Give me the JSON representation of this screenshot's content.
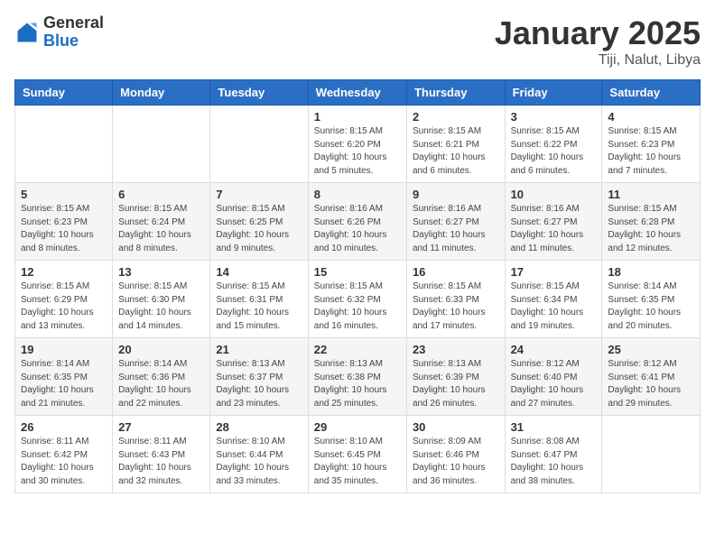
{
  "header": {
    "logo_general": "General",
    "logo_blue": "Blue",
    "title": "January 2025",
    "location": "Tiji, Nalut, Libya"
  },
  "days_of_week": [
    "Sunday",
    "Monday",
    "Tuesday",
    "Wednesday",
    "Thursday",
    "Friday",
    "Saturday"
  ],
  "weeks": [
    [
      {
        "day": "",
        "info": ""
      },
      {
        "day": "",
        "info": ""
      },
      {
        "day": "",
        "info": ""
      },
      {
        "day": "1",
        "info": "Sunrise: 8:15 AM\nSunset: 6:20 PM\nDaylight: 10 hours and 5 minutes."
      },
      {
        "day": "2",
        "info": "Sunrise: 8:15 AM\nSunset: 6:21 PM\nDaylight: 10 hours and 6 minutes."
      },
      {
        "day": "3",
        "info": "Sunrise: 8:15 AM\nSunset: 6:22 PM\nDaylight: 10 hours and 6 minutes."
      },
      {
        "day": "4",
        "info": "Sunrise: 8:15 AM\nSunset: 6:23 PM\nDaylight: 10 hours and 7 minutes."
      }
    ],
    [
      {
        "day": "5",
        "info": "Sunrise: 8:15 AM\nSunset: 6:23 PM\nDaylight: 10 hours and 8 minutes."
      },
      {
        "day": "6",
        "info": "Sunrise: 8:15 AM\nSunset: 6:24 PM\nDaylight: 10 hours and 8 minutes."
      },
      {
        "day": "7",
        "info": "Sunrise: 8:15 AM\nSunset: 6:25 PM\nDaylight: 10 hours and 9 minutes."
      },
      {
        "day": "8",
        "info": "Sunrise: 8:16 AM\nSunset: 6:26 PM\nDaylight: 10 hours and 10 minutes."
      },
      {
        "day": "9",
        "info": "Sunrise: 8:16 AM\nSunset: 6:27 PM\nDaylight: 10 hours and 11 minutes."
      },
      {
        "day": "10",
        "info": "Sunrise: 8:16 AM\nSunset: 6:27 PM\nDaylight: 10 hours and 11 minutes."
      },
      {
        "day": "11",
        "info": "Sunrise: 8:15 AM\nSunset: 6:28 PM\nDaylight: 10 hours and 12 minutes."
      }
    ],
    [
      {
        "day": "12",
        "info": "Sunrise: 8:15 AM\nSunset: 6:29 PM\nDaylight: 10 hours and 13 minutes."
      },
      {
        "day": "13",
        "info": "Sunrise: 8:15 AM\nSunset: 6:30 PM\nDaylight: 10 hours and 14 minutes."
      },
      {
        "day": "14",
        "info": "Sunrise: 8:15 AM\nSunset: 6:31 PM\nDaylight: 10 hours and 15 minutes."
      },
      {
        "day": "15",
        "info": "Sunrise: 8:15 AM\nSunset: 6:32 PM\nDaylight: 10 hours and 16 minutes."
      },
      {
        "day": "16",
        "info": "Sunrise: 8:15 AM\nSunset: 6:33 PM\nDaylight: 10 hours and 17 minutes."
      },
      {
        "day": "17",
        "info": "Sunrise: 8:15 AM\nSunset: 6:34 PM\nDaylight: 10 hours and 19 minutes."
      },
      {
        "day": "18",
        "info": "Sunrise: 8:14 AM\nSunset: 6:35 PM\nDaylight: 10 hours and 20 minutes."
      }
    ],
    [
      {
        "day": "19",
        "info": "Sunrise: 8:14 AM\nSunset: 6:35 PM\nDaylight: 10 hours and 21 minutes."
      },
      {
        "day": "20",
        "info": "Sunrise: 8:14 AM\nSunset: 6:36 PM\nDaylight: 10 hours and 22 minutes."
      },
      {
        "day": "21",
        "info": "Sunrise: 8:13 AM\nSunset: 6:37 PM\nDaylight: 10 hours and 23 minutes."
      },
      {
        "day": "22",
        "info": "Sunrise: 8:13 AM\nSunset: 6:38 PM\nDaylight: 10 hours and 25 minutes."
      },
      {
        "day": "23",
        "info": "Sunrise: 8:13 AM\nSunset: 6:39 PM\nDaylight: 10 hours and 26 minutes."
      },
      {
        "day": "24",
        "info": "Sunrise: 8:12 AM\nSunset: 6:40 PM\nDaylight: 10 hours and 27 minutes."
      },
      {
        "day": "25",
        "info": "Sunrise: 8:12 AM\nSunset: 6:41 PM\nDaylight: 10 hours and 29 minutes."
      }
    ],
    [
      {
        "day": "26",
        "info": "Sunrise: 8:11 AM\nSunset: 6:42 PM\nDaylight: 10 hours and 30 minutes."
      },
      {
        "day": "27",
        "info": "Sunrise: 8:11 AM\nSunset: 6:43 PM\nDaylight: 10 hours and 32 minutes."
      },
      {
        "day": "28",
        "info": "Sunrise: 8:10 AM\nSunset: 6:44 PM\nDaylight: 10 hours and 33 minutes."
      },
      {
        "day": "29",
        "info": "Sunrise: 8:10 AM\nSunset: 6:45 PM\nDaylight: 10 hours and 35 minutes."
      },
      {
        "day": "30",
        "info": "Sunrise: 8:09 AM\nSunset: 6:46 PM\nDaylight: 10 hours and 36 minutes."
      },
      {
        "day": "31",
        "info": "Sunrise: 8:08 AM\nSunset: 6:47 PM\nDaylight: 10 hours and 38 minutes."
      },
      {
        "day": "",
        "info": ""
      }
    ]
  ]
}
